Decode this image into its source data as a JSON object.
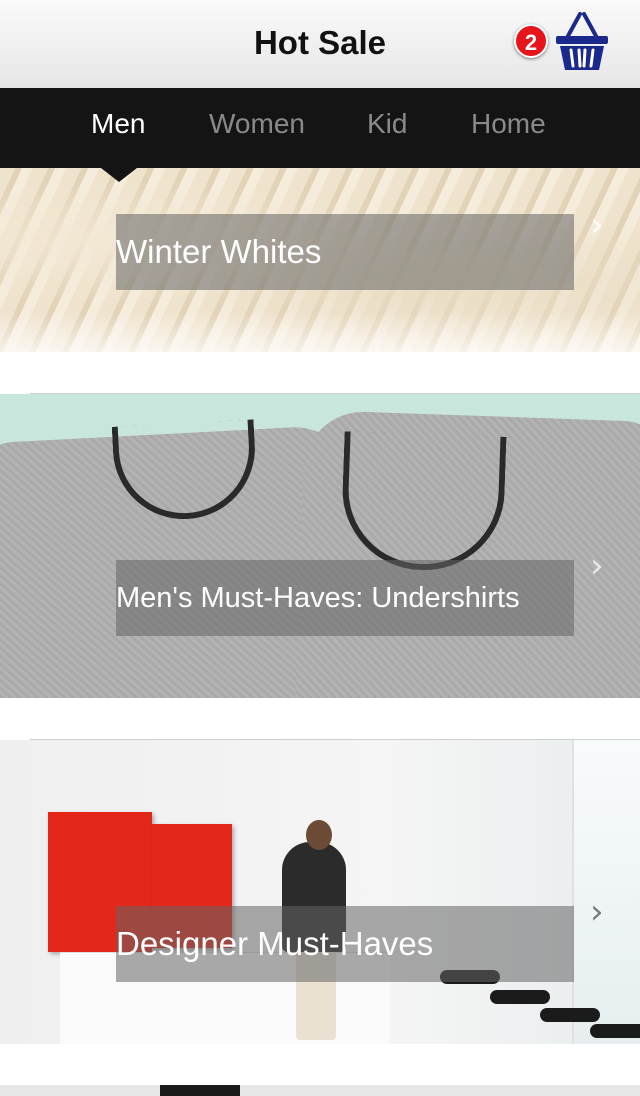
{
  "header": {
    "title": "Hot Sale",
    "cart_count": "2"
  },
  "nav": {
    "tabs": [
      {
        "label": "Men",
        "active": true
      },
      {
        "label": "Women",
        "active": false
      },
      {
        "label": "Kid",
        "active": false
      },
      {
        "label": "Home",
        "active": false
      }
    ]
  },
  "cards": [
    {
      "title": "Winter Whites"
    },
    {
      "title": "Men's Must-Haves: Undershirts"
    },
    {
      "title": "Designer Must-Haves"
    }
  ],
  "colors": {
    "nav_bg": "#141414",
    "badge": "#e8141c",
    "cart_icon": "#1a2a8c"
  },
  "icons": {
    "cart": "basket-icon",
    "row_arrow": "chevron-right-icon"
  }
}
